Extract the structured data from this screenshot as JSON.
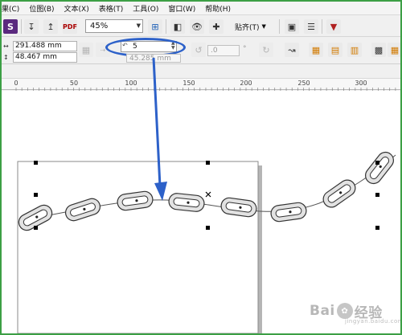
{
  "menu": {
    "items": [
      {
        "label": "果(C)"
      },
      {
        "label": "位图(B)"
      },
      {
        "label": "文本(X)"
      },
      {
        "label": "表格(T)"
      },
      {
        "label": "工具(O)"
      },
      {
        "label": "窗口(W)"
      },
      {
        "label": "帮助(H)"
      }
    ]
  },
  "toolbar": {
    "zoom_value": "45%",
    "snap_label": "贴齐(T)",
    "icons": [
      "import-icon",
      "export-icon",
      "publish-pdf-icon",
      "zoom-fit-icon",
      "full-screen-icon",
      "view-wireframe-icon",
      "show-grid-icon",
      "snap-dropdown-icon",
      "welcome-screen-icon",
      "options-icon",
      "application-launcher-icon"
    ]
  },
  "property_bar": {
    "width_value": "291.488 mm",
    "height_value": "48.467 mm",
    "steps_value": "5",
    "spacing_value": "45.285 mm",
    "angle_value": ".0"
  },
  "ruler": {
    "labels": [
      "0",
      "50",
      "100",
      "150",
      "200",
      "250",
      "300"
    ]
  },
  "watermark": {
    "text_left": "Bai",
    "text_right": "经验",
    "sub": "jingyan.baidu.com"
  },
  "colors": {
    "annotation_blue": "#2d61c9",
    "frame_green": "#3c9f45",
    "page_shadow": "#b5b5b5"
  }
}
